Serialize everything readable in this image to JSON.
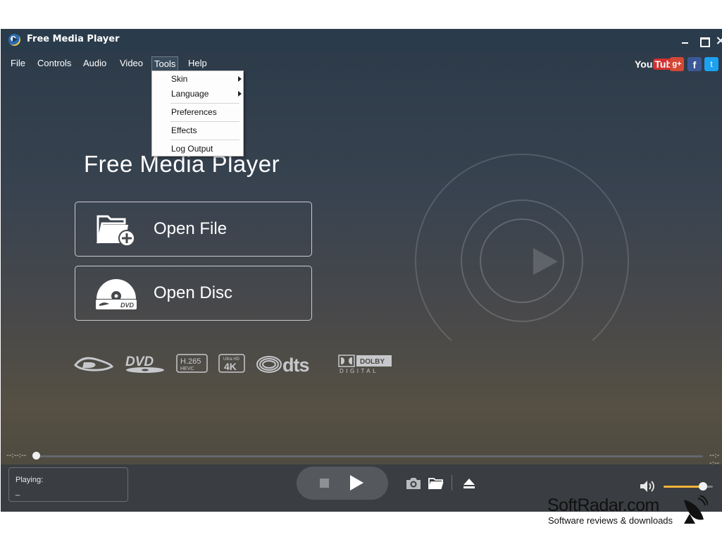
{
  "window": {
    "title": "Free Media Player"
  },
  "menu": {
    "items": [
      {
        "label": "File"
      },
      {
        "label": "Controls"
      },
      {
        "label": "Audio"
      },
      {
        "label": "Video"
      },
      {
        "label": "Tools"
      },
      {
        "label": "Help"
      }
    ],
    "open_menu": "Tools"
  },
  "tools_dropdown": {
    "items": [
      {
        "label": "Skin",
        "submenu": true
      },
      {
        "label": "Language",
        "submenu": true
      },
      {
        "label": "Preferences",
        "submenu": false
      },
      {
        "label": "Effects",
        "submenu": false
      },
      {
        "label": "Log Output",
        "submenu": false
      }
    ]
  },
  "social": {
    "youtube": {
      "you": "You",
      "tube": "Tube",
      "icon": "youtube-icon"
    },
    "gplus": {
      "text": "g+",
      "icon": "google-plus-icon"
    },
    "facebook": {
      "text": "f",
      "icon": "facebook-icon"
    },
    "twitter": {
      "text": "t",
      "icon": "twitter-icon"
    }
  },
  "hero": {
    "title": "Free Media Player",
    "open_file_label": "Open File",
    "open_disc_label": "Open Disc"
  },
  "formats": {
    "dvd": "DVD",
    "h265": "H.265",
    "hevc": "HEVC",
    "ultra_hd": "Ultra HD",
    "k4": "4K",
    "dts": "dts",
    "dolby": "DOLBY",
    "digital": "DIGITAL"
  },
  "playback": {
    "time_elapsed": "--:--:--",
    "time_remaining": "--:--:--",
    "progress": 0.0,
    "playing_label": "Playing:",
    "playing_value": "_",
    "volume": 0.8
  },
  "colors": {
    "accent_volume": "#f4b23a",
    "titlebar": "#2a3b4c"
  },
  "watermark": {
    "brand": "SoftRadar.com",
    "tagline": "Software reviews & downloads"
  }
}
